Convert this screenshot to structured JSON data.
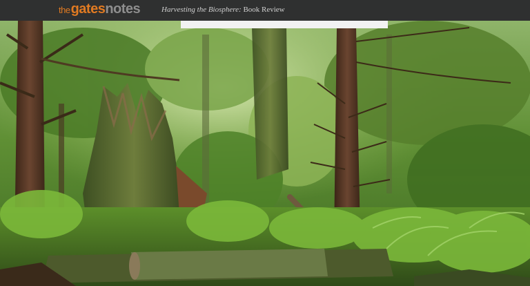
{
  "header": {
    "logo_the": "the",
    "logo_gates": "gates",
    "logo_notes": "notes",
    "book_title": "Harvesting the Biosphere:",
    "title_suffix": " Book Review"
  },
  "hero": {
    "description_icon": "forest-photo"
  },
  "colors": {
    "header_bg": "#2f3030",
    "logo_orange": "#e07a22",
    "logo_gray": "#8e8e8e"
  }
}
